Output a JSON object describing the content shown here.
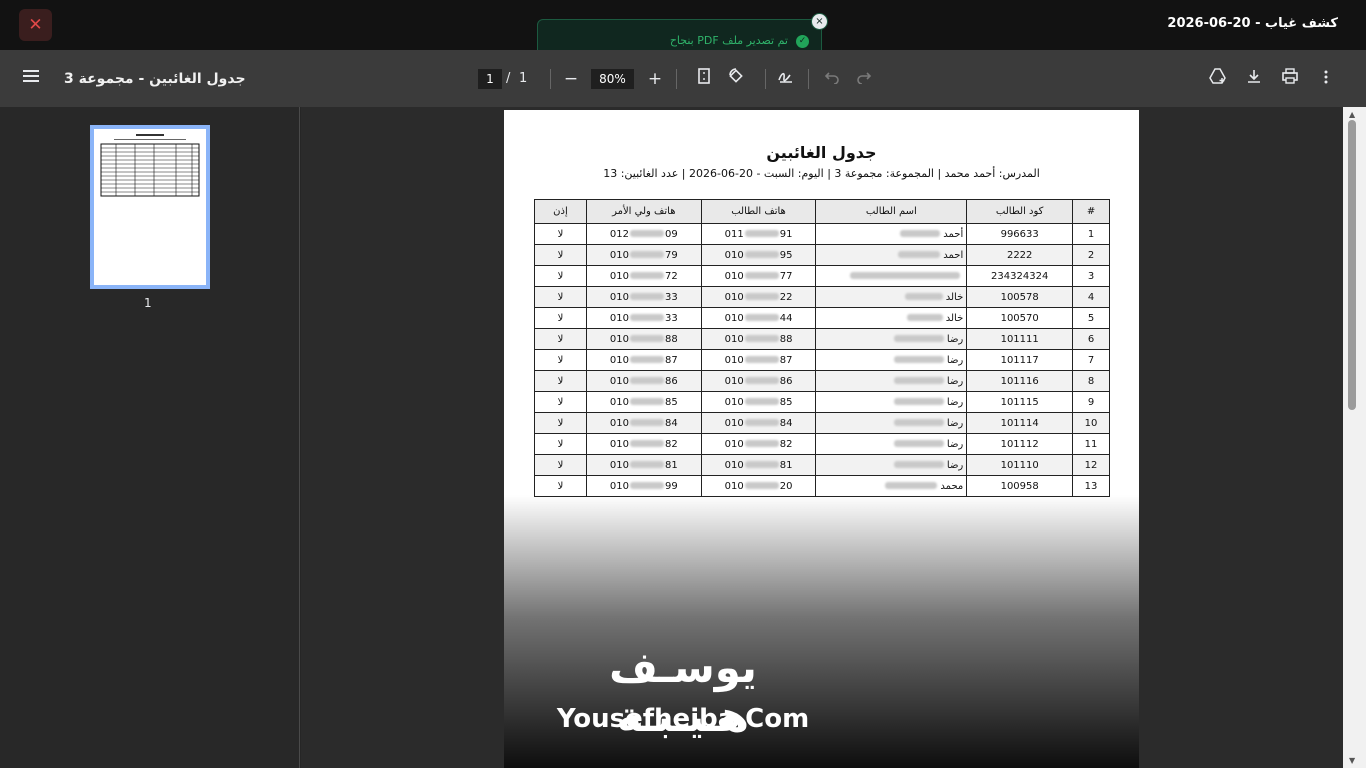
{
  "window": {
    "title": "كشف غياب - 20-06-2026",
    "close_glyph": "✕"
  },
  "toast": {
    "message": "تم تصدير ملف PDF بنجاح",
    "close_glyph": "×",
    "check_glyph": "✓"
  },
  "toolbar": {
    "doc_title": "جدول الغائبين - مجموعة 3",
    "current_page": "1",
    "page_separator": "/",
    "total_pages": "1",
    "zoom": "80%",
    "zoom_out_glyph": "−",
    "zoom_in_glyph": "+",
    "icons": [
      "menu-icon",
      "zoom-out-icon",
      "zoom-in-icon",
      "fit-page-icon",
      "rotate-icon",
      "annotate-icon",
      "undo-icon",
      "redo-icon",
      "drive-add-icon",
      "download-icon",
      "print-icon",
      "more-icon"
    ]
  },
  "sidebar": {
    "thumb_label": "1"
  },
  "document": {
    "heading": "جدول الغائبين",
    "meta": "المدرس: أحمد محمد   |   المجموعة: مجموعة 3   |   اليوم: السبت - 20-06-2026   |   عدد الغائبين: 13",
    "headers": [
      "#",
      "كود الطالب",
      "اسم الطالب",
      "هاتف الطالب",
      "هاتف ولي الأمر",
      "إذن"
    ],
    "rows": [
      {
        "n": "1",
        "code": "996633",
        "name": "أحمد",
        "phone": "011█████91",
        "parent": "012█████09",
        "perm": "لا"
      },
      {
        "n": "2",
        "code": "2222",
        "name": "احمد",
        "phone": "010█████95",
        "parent": "010█████79",
        "perm": "لا"
      },
      {
        "n": "3",
        "code": "234324324",
        "name": "",
        "phone": "010█████77",
        "parent": "010█████72",
        "perm": "لا"
      },
      {
        "n": "4",
        "code": "100578",
        "name": "خالد",
        "phone": "010█████22",
        "parent": "010█████33",
        "perm": "لا"
      },
      {
        "n": "5",
        "code": "100570",
        "name": "خالد",
        "phone": "010█████44",
        "parent": "010█████33",
        "perm": "لا"
      },
      {
        "n": "6",
        "code": "101111",
        "name": "رضا",
        "phone": "010█████88",
        "parent": "010█████88",
        "perm": "لا"
      },
      {
        "n": "7",
        "code": "101117",
        "name": "رضا",
        "phone": "010█████87",
        "parent": "010█████87",
        "perm": "لا"
      },
      {
        "n": "8",
        "code": "101116",
        "name": "رضا",
        "phone": "010█████86",
        "parent": "010█████86",
        "perm": "لا"
      },
      {
        "n": "9",
        "code": "101115",
        "name": "رضا",
        "phone": "010█████85",
        "parent": "010█████85",
        "perm": "لا"
      },
      {
        "n": "10",
        "code": "101114",
        "name": "رضا",
        "phone": "010█████84",
        "parent": "010█████84",
        "perm": "لا"
      },
      {
        "n": "11",
        "code": "101112",
        "name": "رضا",
        "phone": "010█████82",
        "parent": "010█████82",
        "perm": "لا"
      },
      {
        "n": "12",
        "code": "101110",
        "name": "رضا",
        "phone": "010█████81",
        "parent": "010█████81",
        "perm": "لا"
      },
      {
        "n": "13",
        "code": "100958",
        "name": "محمد",
        "phone": "010█████20",
        "parent": "010█████99",
        "perm": "لا"
      }
    ]
  },
  "watermark": {
    "arabic": "يوسـف هـيـبـة",
    "english": "Yousefheiba.Com"
  },
  "colors": {
    "toast_bg": "#10271f",
    "toast_text": "#2fb36a",
    "close_red": "#e04848",
    "thumb_border": "#8ab4f8"
  }
}
